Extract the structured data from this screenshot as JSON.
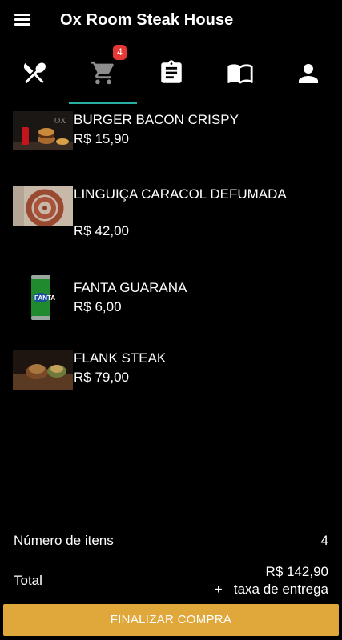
{
  "app": {
    "title": "Ox Room Steak House"
  },
  "tabs": [
    {
      "icon": "utensils-icon"
    },
    {
      "icon": "cart-icon",
      "badge": "4"
    },
    {
      "icon": "clipboard-icon"
    },
    {
      "icon": "book-icon"
    },
    {
      "icon": "person-icon"
    }
  ],
  "colors": {
    "accent": "#2ab0a3",
    "badge": "#e53935",
    "checkout": "#e0a73b"
  },
  "cart": {
    "items": [
      {
        "name": "BURGER BACON CRISPY",
        "price": "R$ 15,90"
      },
      {
        "name": "LINGUIÇA CARACOL DEFUMADA",
        "price": "R$ 42,00"
      },
      {
        "name": "FANTA GUARANA",
        "price": "R$ 6,00"
      },
      {
        "name": "FLANK STEAK",
        "price": "R$ 79,00"
      }
    ]
  },
  "summary": {
    "count_label": "Número de itens",
    "count_value": "4",
    "total_label": "Total",
    "total_value": "R$ 142,90",
    "delivery_note": "+   taxa de entrega"
  },
  "checkout": {
    "label": "FINALIZAR COMPRA"
  }
}
